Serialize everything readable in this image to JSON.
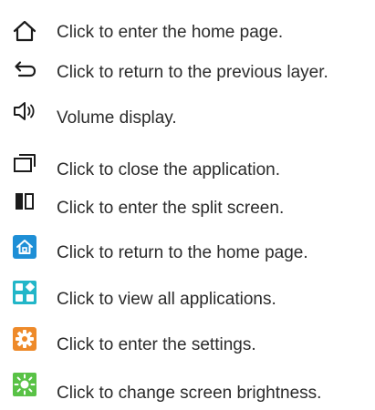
{
  "icon_legend": {
    "colors": {
      "outline": "#1b1b1b",
      "home_blue": "#1e8fd6",
      "apps_teal": "#22b6c8",
      "settings_orange": "#ee8a2a",
      "brightness_green": "#59c246"
    },
    "items": [
      {
        "icon": "home-outline-icon",
        "text": "Click to enter the home page."
      },
      {
        "icon": "back-arrow-icon",
        "text": "Click to return to the previous layer."
      },
      {
        "icon": "volume-icon",
        "text": "Volume display."
      },
      {
        "icon": "recent-apps-icon",
        "text": "Click to close the application."
      },
      {
        "icon": "split-screen-icon",
        "text": "Click to enter the split screen."
      },
      {
        "icon": "home-app-icon",
        "text": "Click to return to the home page."
      },
      {
        "icon": "all-apps-icon",
        "text": "Click to view all applications."
      },
      {
        "icon": "settings-icon",
        "text": "Click to enter the settings."
      },
      {
        "icon": "brightness-icon",
        "text": "Click to change screen brightness."
      }
    ]
  }
}
